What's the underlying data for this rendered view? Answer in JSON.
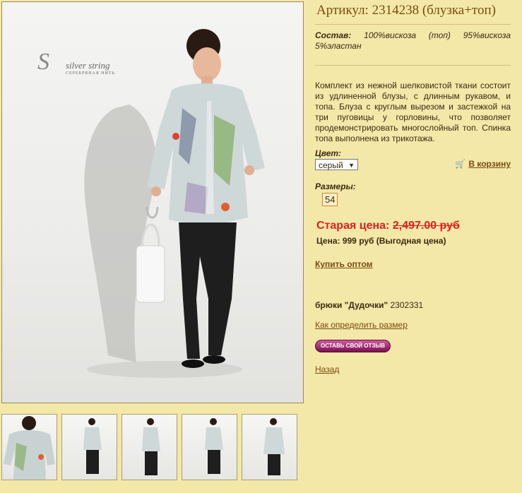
{
  "product": {
    "title": "Артикул: 2314238 (блузка+топ)",
    "composition_label": "Состав:",
    "composition_value": "100%вискоза (топ) 95%вискоза 5%эластан",
    "description": "Комплект из нежной шелковистой ткани состоит из удлиненной блузы, с длинным рукавом, и топа. Блуза с круглым вырезом и застежкой на три пуговицы у горловины, что позволяет продемонстрировать многослойный топ. Спинка топа выполнена из трикотажа.",
    "color_label": "Цвет:",
    "color_value": "серый",
    "cart_label": "В корзину",
    "sizes_label": "Размеры:",
    "size_value": "54",
    "old_price_label": "Старая цена:",
    "old_price_value": "2,497.00 руб",
    "new_price": "Цена: 999 руб (Выгодная цена)",
    "wholesale_label": "Купить оптом",
    "related_name": "брюки \"Дудочки\"",
    "related_code": "2302331",
    "size_guide_label": "Как определить размер",
    "review_button": "ОСТАВЬ СВОЙ ОТЗЫВ",
    "back_label": "Назад"
  },
  "brand": {
    "logo_letter": "S",
    "logo_name": "silver string",
    "logo_sub": "СЕРЕБРЯНАЯ НИТЬ"
  },
  "gallery": {
    "thumbnail_count": 5
  },
  "colors": {
    "background": "#f3e8a8",
    "title": "#7a4a10",
    "old_price": "#e02020",
    "review_button": "#b0307a"
  }
}
